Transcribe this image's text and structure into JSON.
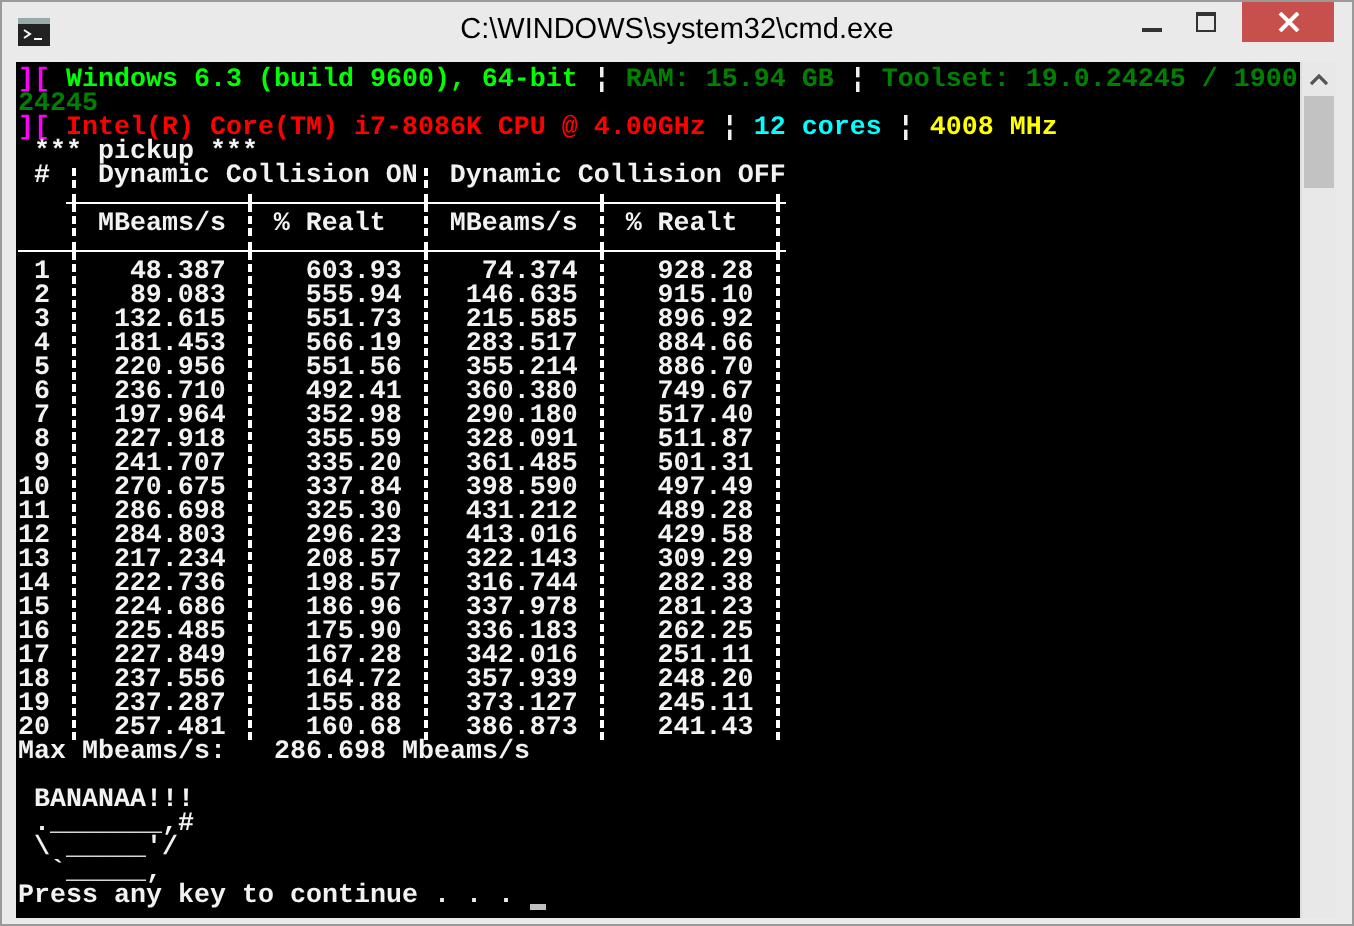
{
  "window": {
    "title": "C:\\WINDOWS\\system32\\cmd.exe"
  },
  "console": {
    "info_lines": [
      {
        "segments": [
          {
            "text": "][",
            "color": "#ff00ff"
          },
          {
            "text": "Windows 6.3 (build 9600), 64-bit",
            "color": "#00ff00"
          },
          {
            "text": "¦",
            "color": "#f2f2f2"
          },
          {
            "text": "RAM: 15.94 GB",
            "color": "#008000"
          },
          {
            "text": "¦",
            "color": "#f2f2f2"
          },
          {
            "text": "Toolset: 19.0.24245 / 1900",
            "color": "#008000"
          }
        ]
      },
      {
        "segments": [
          {
            "text": "24245",
            "color": "#008000"
          }
        ]
      },
      {
        "segments": [
          {
            "text": "][",
            "color": "#ff00ff"
          },
          {
            "text": "Intel(R) Core(TM) i7-8086K CPU @ 4.00GHz",
            "color": "#ff0000"
          },
          {
            "text": "¦",
            "color": "#f2f2f2"
          },
          {
            "text": "12 cores",
            "color": "#00ffff"
          },
          {
            "text": "¦",
            "color": "#f2f2f2"
          },
          {
            "text": "4008 MHz",
            "color": "#ffff00"
          }
        ]
      }
    ],
    "table": {
      "title": "*** pickup ***",
      "index_header": "#",
      "groups": [
        {
          "label": "Dynamic Collision ON",
          "columns": [
            "MBeams/s",
            "% Realt"
          ]
        },
        {
          "label": "Dynamic Collision OFF",
          "columns": [
            "MBeams/s",
            "% Realt"
          ]
        }
      ],
      "rows": [
        {
          "index": "1",
          "values": [
            "48.387",
            "603.93",
            "74.374",
            "928.28"
          ]
        },
        {
          "index": "2",
          "values": [
            "89.083",
            "555.94",
            "146.635",
            "915.10"
          ]
        },
        {
          "index": "3",
          "values": [
            "132.615",
            "551.73",
            "215.585",
            "896.92"
          ]
        },
        {
          "index": "4",
          "values": [
            "181.453",
            "566.19",
            "283.517",
            "884.66"
          ]
        },
        {
          "index": "5",
          "values": [
            "220.956",
            "551.56",
            "355.214",
            "886.70"
          ]
        },
        {
          "index": "6",
          "values": [
            "236.710",
            "492.41",
            "360.380",
            "749.67"
          ]
        },
        {
          "index": "7",
          "values": [
            "197.964",
            "352.98",
            "290.180",
            "517.40"
          ]
        },
        {
          "index": "8",
          "values": [
            "227.918",
            "355.59",
            "328.091",
            "511.87"
          ]
        },
        {
          "index": "9",
          "values": [
            "241.707",
            "335.20",
            "361.485",
            "501.31"
          ]
        },
        {
          "index": "10",
          "values": [
            "270.675",
            "337.84",
            "398.590",
            "497.49"
          ]
        },
        {
          "index": "11",
          "values": [
            "286.698",
            "325.30",
            "431.212",
            "489.28"
          ]
        },
        {
          "index": "12",
          "values": [
            "284.803",
            "296.23",
            "413.016",
            "429.58"
          ]
        },
        {
          "index": "13",
          "values": [
            "217.234",
            "208.57",
            "322.143",
            "309.29"
          ]
        },
        {
          "index": "14",
          "values": [
            "222.736",
            "198.57",
            "316.744",
            "282.38"
          ]
        },
        {
          "index": "15",
          "values": [
            "224.686",
            "186.96",
            "337.978",
            "281.23"
          ]
        },
        {
          "index": "16",
          "values": [
            "225.485",
            "175.90",
            "336.183",
            "262.25"
          ]
        },
        {
          "index": "17",
          "values": [
            "227.849",
            "167.28",
            "342.016",
            "251.11"
          ]
        },
        {
          "index": "18",
          "values": [
            "237.556",
            "164.72",
            "357.939",
            "248.20"
          ]
        },
        {
          "index": "19",
          "values": [
            "237.287",
            "155.88",
            "373.127",
            "245.11"
          ]
        },
        {
          "index": "20",
          "values": [
            "257.481",
            "160.68",
            "386.873",
            "241.43"
          ]
        }
      ]
    },
    "summary": {
      "label": "Max Mbeams/s:",
      "value": "286.698 Mbeams/s"
    },
    "art_lines": [
      "BANANAA!!!",
      "._______,#",
      "\\ _____'/",
      " `_____,"
    ],
    "prompt": "Press any key to continue . . ."
  }
}
